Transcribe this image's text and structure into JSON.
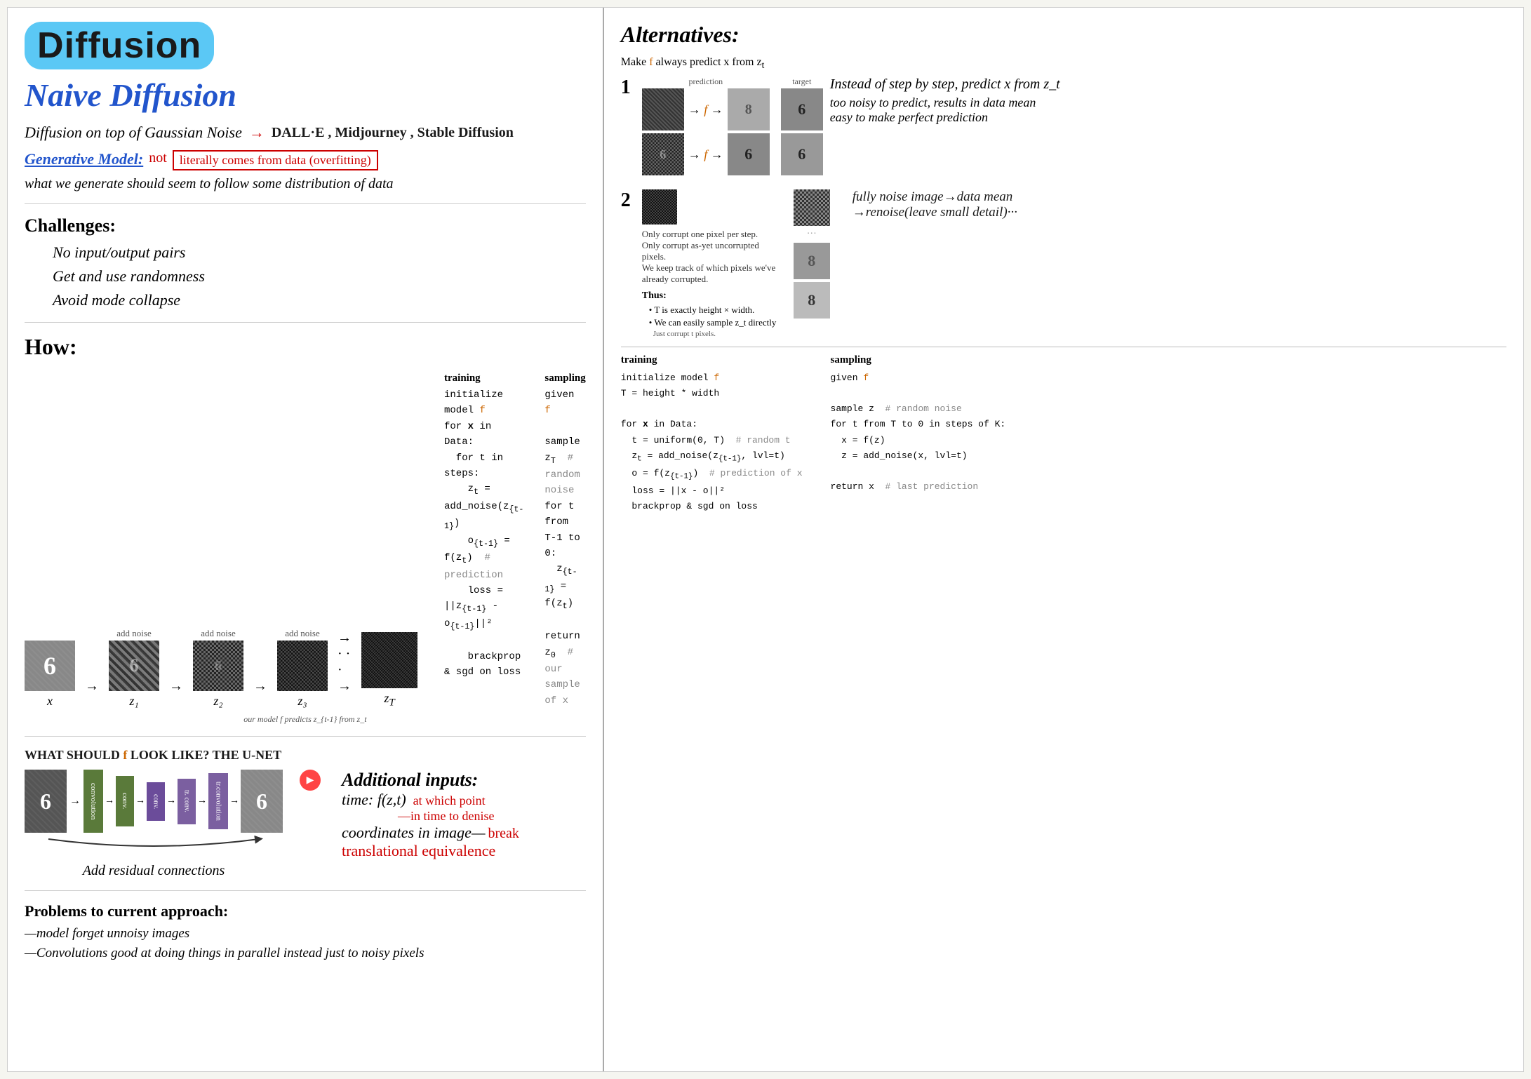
{
  "left": {
    "title_diffusion": "Diffusion",
    "title_naive": "Naive Diffusion",
    "gaussian_line": "Diffusion on top of Gaussian Noise",
    "arrow": "→",
    "dall_e": "DALL·E , Midjourney , Stable Diffusion",
    "gen_model_label": "Generative Model:",
    "not_text": "not",
    "literally_box": "literally comes from data (overfitting)",
    "gen_desc": "what we generate should seem to follow some distribution of data",
    "challenges_title": "Challenges:",
    "challenges": [
      "No input/output pairs",
      "Get and use randomness",
      "Avoid mode collapse"
    ],
    "how_title": "How:",
    "noise_labels": [
      "x",
      "z₁",
      "z₂",
      "z₃",
      "zT"
    ],
    "add_noise": "add noise",
    "training_title": "training",
    "sampling_title": "sampling",
    "training_code": [
      "initialize model f",
      "for x in Data:",
      "  for t in steps:",
      "    z_t = add_noise(z_{t-1})",
      "    o_{t-1} = f(z_t)  # prediction",
      "    loss = ||z_{t-1} - o_{t-1}||²",
      "",
      "    brackprop & sgd on loss"
    ],
    "sampling_code": [
      "given f",
      "",
      "sample z_T  # random noise",
      "for t from T-1 to 0:",
      "  z_{t-1} = f(z_t)",
      "",
      "return z_0  # our sample of x"
    ],
    "model_predicts": "our model f predicts z_{t-1} from z_t",
    "unet_title": "WHAT SHOULD f LOOK LIKE? THE U-NET",
    "unet_blocks": [
      "convolution",
      "conv.",
      "conv.",
      "tr. conv.",
      "tr.convolution"
    ],
    "additional_inputs_title": "Additional inputs:",
    "time_input": "time: f(z,t)",
    "at_which_point": "at which point",
    "in_time": "—in time to denise",
    "coords_input": "coordinates in image—",
    "break_text": "break",
    "translational": "translational equivalence",
    "add_residual": "Add residual connections",
    "problems_title": "Problems to current approach:",
    "problems": [
      "—model forget unnoisy images",
      "—Convolutions good at doing things in parallel instead just to noisy pixels"
    ]
  },
  "right": {
    "alternatives_title": "Alternatives:",
    "make_f_line": "Make f always predict x from z_t",
    "section1_num": "1",
    "section2_num": "2",
    "instead_text": "Instead of step by step, predict x from z_t",
    "too_noisy": "too noisy to predict, results in data mean",
    "easy_predict": "easy to make perfect prediction",
    "corrupt_title": "Only corrupt one pixel per step.",
    "corrupt_uncorrupted": "Only corrupt as-yet uncorrupted pixels.",
    "keep_track": "We keep track of which pixels we've already corrupted.",
    "thus_title": "Thus:",
    "thus_bullets": [
      "T is exactly height × width.",
      "We can easily sample z_t directly",
      "Just corrupt t pixels."
    ],
    "training_title": "training",
    "sampling_title": "sampling",
    "training_code": [
      "initialize model f",
      "T = height * width",
      "",
      "for x in Data:",
      "  t = uniform(0, T)  # random t",
      "  z_t = add_noise(z_{t-1}, lvl=t)",
      "  o = f(z_{t-1})  # prediction of x",
      "  loss = ||x - o||²",
      "  brackprop & sgd on loss"
    ],
    "given_f": "given f",
    "sampling_code": [
      "sample z  # random noise",
      "for t from T to 0 in steps of K:",
      "  x = f(z)",
      "  z = add_noise(x, lvl=t)",
      "",
      "return x  # last prediction"
    ],
    "fully_noise": "fully noise image→data mean",
    "renoise": "→renoise(leave small detail)···",
    "from_text": "from"
  }
}
